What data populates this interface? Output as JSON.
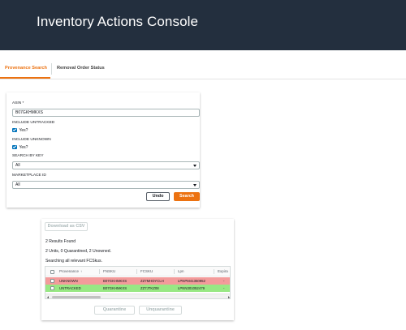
{
  "header": {
    "title": "Inventory Actions Console"
  },
  "tabs": [
    {
      "label": "Provenance Search",
      "active": true
    },
    {
      "label": "Removal Order Status",
      "active": false
    }
  ],
  "form": {
    "asin_label": "ASIN *",
    "asin_value": "B07GKHMKXS",
    "include_untracked_label": "INCLUDE UNTRACKED",
    "include_untracked_checkbox_label": "Yes?",
    "include_unknown_label": "INCLUDE UNKNOWN",
    "include_unknown_checkbox_label": "Yes?",
    "search_by_key_label": "SEARCH BY KEY",
    "search_by_key_value": "All",
    "marketplace_label": "MARKETPLACE ID",
    "marketplace_value": "All",
    "undo_label": "Undo",
    "search_label": "Search"
  },
  "results": {
    "download_label": "Download as CSV",
    "count_text": "2 Results Found",
    "summary_text": "2 Units, 0 Quarantined, 2 Unowned.",
    "searching_text": "Searching all relevant FCSkus.",
    "columns": [
      "Provenance",
      "FNSKU",
      "FCSKU",
      "Lpn",
      "Expira"
    ],
    "rows": [
      {
        "provenance": "UNKNOWN",
        "fnsku": "B07GKHMKXS",
        "fcsku": "ZZ7MHDYCLH",
        "lpn": "LPNPM41350952",
        "expira": "-"
      },
      {
        "provenance": "UNTRACKED",
        "fnsku": "B07GKHMKXS",
        "fcsku": "ZZ7JTKZ08",
        "lpn": "LPNN301052479",
        "expira": "-"
      }
    ],
    "quarantine_label": "Quarantine",
    "unquarantine_label": "Unquarantine"
  },
  "colors": {
    "header_bg": "#232f3e",
    "accent": "#ec7211",
    "checkbox": "#0073bb",
    "row_unknown": "#f39b9b",
    "row_untracked": "#98e884"
  },
  "icons": [
    "checkbox-checked-icon",
    "caret-down-icon",
    "sort-icon",
    "scroll-left-icon",
    "scroll-right-icon"
  ]
}
